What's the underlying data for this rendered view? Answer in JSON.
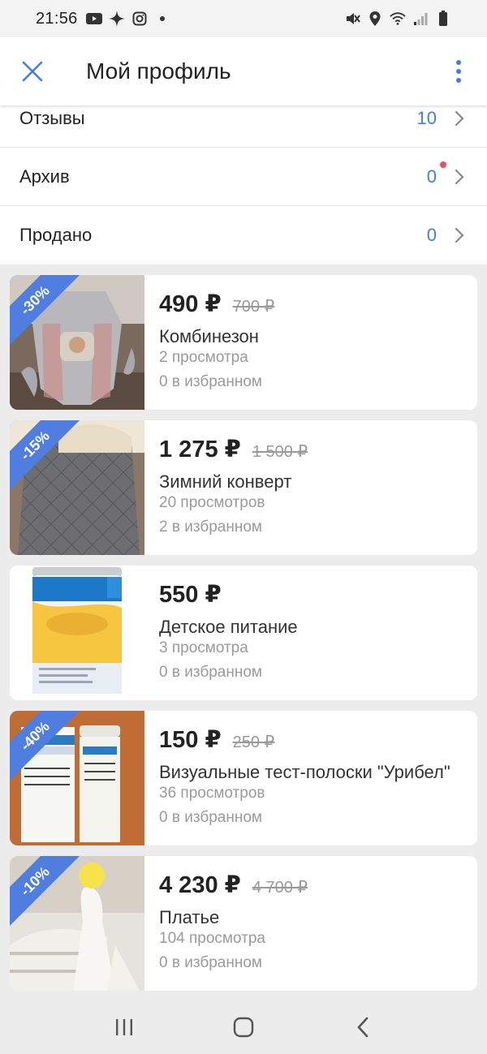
{
  "status_bar": {
    "time": "21:56"
  },
  "header": {
    "title": "Мой профиль"
  },
  "rows": [
    {
      "label": "Отзывы",
      "count": "10",
      "dot": false
    },
    {
      "label": "Архив",
      "count": "0",
      "dot": true
    },
    {
      "label": "Продано",
      "count": "0",
      "dot": false
    }
  ],
  "listings": [
    {
      "discount": "-30%",
      "price": "490 ₽",
      "old_price": "700 ₽",
      "title": "Комбинезон",
      "views": "2 просмотра",
      "favorites": "0 в избранном"
    },
    {
      "discount": "-15%",
      "price": "1 275 ₽",
      "old_price": "1 500 ₽",
      "title": "Зимний конверт",
      "views": "20 просмотров",
      "favorites": "2 в избранном"
    },
    {
      "discount": "",
      "price": "550 ₽",
      "old_price": "",
      "title": "Детское питание",
      "views": "3 просмотра",
      "favorites": "0 в избранном"
    },
    {
      "discount": "-40%",
      "price": "150 ₽",
      "old_price": "250 ₽",
      "title": "Визуальные тест-полоски \"Урибел\"",
      "views": "36 просмотров",
      "favorites": "0 в избранном"
    },
    {
      "discount": "-10%",
      "price": "4 230 ₽",
      "old_price": "4 700 ₽",
      "title": "Платье",
      "views": "104 просмотра",
      "favorites": "0 в избранном"
    }
  ],
  "colors": {
    "accent": "#3f7fe4",
    "badge": "#4f7de0",
    "notification_dot": "#f04b5a"
  }
}
